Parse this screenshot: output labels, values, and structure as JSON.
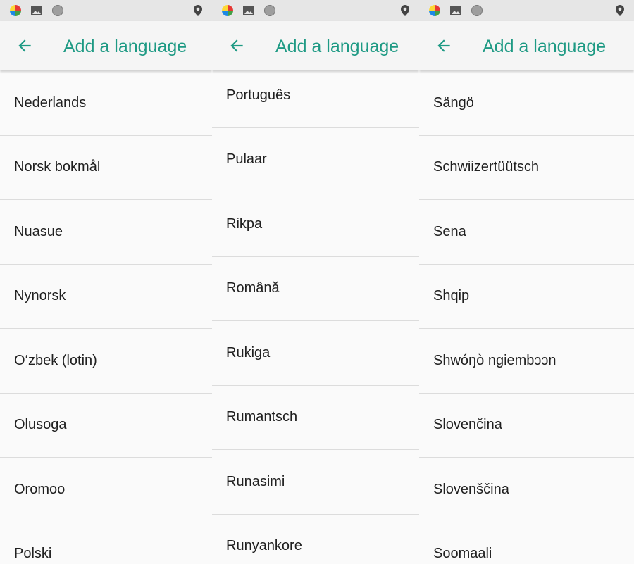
{
  "colors": {
    "accent": "#1e9a84",
    "statusbar": "#e6e6e6",
    "appbar": "#f5f5f5",
    "background": "#fafafa",
    "divider": "#dcdcdc"
  },
  "icons": {
    "back": "arrow-left-icon",
    "status": [
      "app-icon",
      "gallery-icon",
      "dot-icon",
      "location-icon"
    ]
  },
  "panels": [
    {
      "title": "Add a language",
      "items": [
        "Nederlands",
        "Norsk bokmål",
        "Nuasue",
        "Nynorsk",
        "O‘zbek (lotin)",
        "Olusoga",
        "Oromoo",
        "Polski"
      ]
    },
    {
      "title": "Add a language",
      "items": [
        "Português",
        "Pulaar",
        "Rikpa",
        "Română",
        "Rukiga",
        "Rumantsch",
        "Runasimi",
        "Runyankore"
      ]
    },
    {
      "title": "Add a language",
      "items": [
        "Sängö",
        "Schwiizertüütsch",
        "Sena",
        "Shqip",
        "Shwóŋò ngiembɔɔn",
        "Slovenčina",
        "Slovenščina",
        "Soomaali"
      ]
    }
  ]
}
